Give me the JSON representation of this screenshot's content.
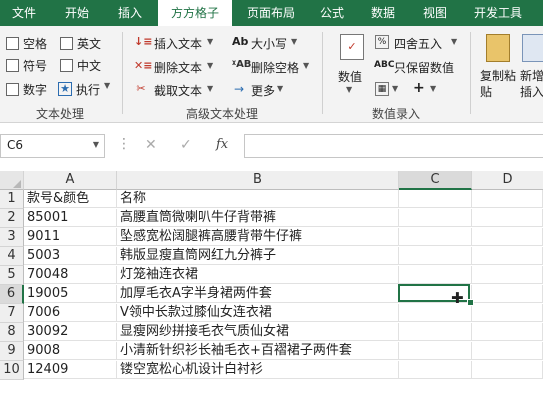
{
  "tabs": [
    "文件",
    "开始",
    "插入",
    "方方格子",
    "页面布局",
    "公式",
    "数据",
    "视图",
    "开发工具"
  ],
  "ribbon": {
    "text_group": {
      "checkboxes": [
        "空格",
        "英文",
        "符号",
        "中文",
        "数字"
      ],
      "execute": "执行",
      "label": "文本处理"
    },
    "adv_group": {
      "insert_text": "插入文本",
      "delete_text": "删除文本",
      "cut_text": "截取文本",
      "case": "大小写",
      "delete_spaces": "删除空格",
      "more": "更多",
      "label": "高级文本处理"
    },
    "num_group": {
      "value": "数值",
      "round": "四舍五入",
      "keep_values": "只保留数值",
      "label": "数值录入"
    },
    "copy_paste": "复制粘贴",
    "new_insert": "新增插入"
  },
  "formula_bar": {
    "name_box": "C6",
    "fx": "fx",
    "value": ""
  },
  "columns": [
    "A",
    "B",
    "C",
    "D"
  ],
  "rows": [
    {
      "n": "1",
      "a": "款号&颜色",
      "b": "名称"
    },
    {
      "n": "2",
      "a": "85001",
      "b": "高腰直筒微喇叭牛仔背带裤"
    },
    {
      "n": "3",
      "a": "9011",
      "b": "坠感宽松阔腿裤高腰背带牛仔裤"
    },
    {
      "n": "4",
      "a": "5003",
      "b": "韩版显瘦直筒网红九分裤子"
    },
    {
      "n": "5",
      "a": "70048",
      "b": "灯笼袖连衣裙"
    },
    {
      "n": "6",
      "a": "19005",
      "b": "加厚毛衣A字半身裙两件套"
    },
    {
      "n": "7",
      "a": "7006",
      "b": "V领中长款过膝仙女连衣裙"
    },
    {
      "n": "8",
      "a": "30092",
      "b": "显瘦网纱拼接毛衣气质仙女裙"
    },
    {
      "n": "9",
      "a": "9008",
      "b": "小清新针织衫长袖毛衣+百褶裙子两件套"
    },
    {
      "n": "10",
      "a": "12409",
      "b": "镂空宽松心机设计白衬衫"
    }
  ]
}
